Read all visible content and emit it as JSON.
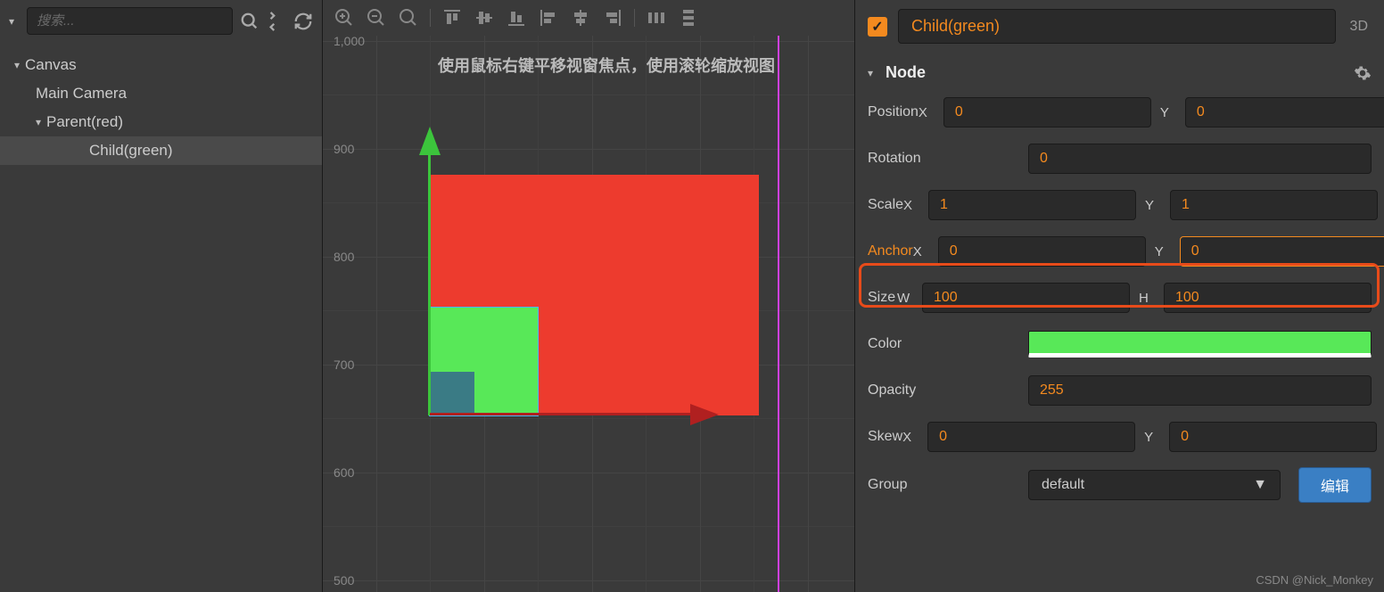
{
  "hierarchy": {
    "search_placeholder": "搜索...",
    "items": [
      {
        "label": "Canvas",
        "indent": 0,
        "expanded": true,
        "selected": false
      },
      {
        "label": "Main Camera",
        "indent": 1,
        "expanded": null,
        "selected": false
      },
      {
        "label": "Parent(red)",
        "indent": 1,
        "expanded": true,
        "selected": false
      },
      {
        "label": "Child(green)",
        "indent": 2,
        "expanded": null,
        "selected": true
      }
    ]
  },
  "scene": {
    "hint": "使用鼠标右键平移视窗焦点，使用滚轮缩放视图",
    "ruler_ticks": [
      "1,000",
      "900",
      "800",
      "700",
      "600",
      "500"
    ]
  },
  "inspector": {
    "node_name": "Child(green)",
    "mode_label": "3D",
    "section_title": "Node",
    "props": {
      "position": {
        "label": "Position",
        "x_label": "X",
        "x": "0",
        "y_label": "Y",
        "y": "0"
      },
      "rotation": {
        "label": "Rotation",
        "value": "0"
      },
      "scale": {
        "label": "Scale",
        "x_label": "X",
        "x": "1",
        "y_label": "Y",
        "y": "1"
      },
      "anchor": {
        "label": "Anchor",
        "x_label": "X",
        "x": "0",
        "y_label": "Y",
        "y": "0"
      },
      "size": {
        "label": "Size",
        "w_label": "W",
        "w": "100",
        "h_label": "H",
        "h": "100"
      },
      "color": {
        "label": "Color",
        "value": "#58e858"
      },
      "opacity": {
        "label": "Opacity",
        "value": "255"
      },
      "skew": {
        "label": "Skew",
        "x_label": "X",
        "x": "0",
        "y_label": "Y",
        "y": "0"
      },
      "group": {
        "label": "Group",
        "value": "default",
        "edit_label": "编辑"
      }
    }
  },
  "watermark": "CSDN @Nick_Monkey"
}
